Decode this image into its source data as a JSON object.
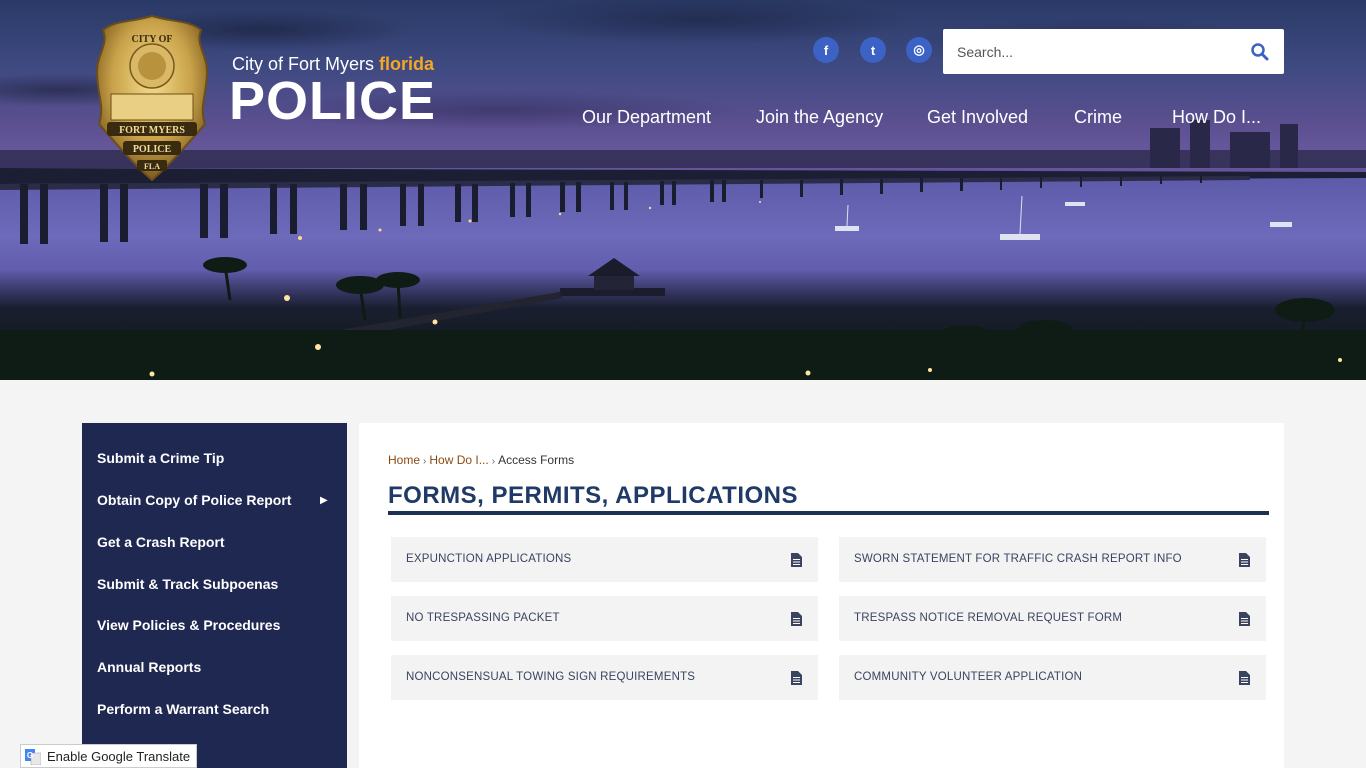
{
  "brand": {
    "city_text": "City of Fort Myers",
    "state_text": "florida",
    "main_text": "POLICE",
    "badge_top": "CITY OF",
    "badge_middle": "FORT MYERS",
    "badge_bottom": "POLICE",
    "badge_state": "FLA"
  },
  "social": {
    "facebook": "f",
    "twitter": "t",
    "instagram": "◎"
  },
  "search": {
    "placeholder": "Search..."
  },
  "nav": {
    "items": [
      {
        "label": "Our Department"
      },
      {
        "label": "Join the Agency"
      },
      {
        "label": "Get Involved"
      },
      {
        "label": "Crime"
      },
      {
        "label": "How Do I..."
      }
    ]
  },
  "sidebar": {
    "items": [
      {
        "label": "Submit a Crime Tip"
      },
      {
        "label": "Obtain Copy of Police Report",
        "arrow": "▶"
      },
      {
        "label": "Get a Crash Report"
      },
      {
        "label": "Submit & Track Subpoenas"
      },
      {
        "label": "View Policies & Procedures"
      },
      {
        "label": "Annual Reports"
      },
      {
        "label": "Perform a Warrant Search"
      }
    ]
  },
  "breadcrumb": {
    "home": "Home",
    "parent": "How Do I...",
    "current": "Access Forms",
    "separator": "›"
  },
  "page": {
    "title": "FORMS, PERMITS, APPLICATIONS"
  },
  "forms": [
    {
      "label": "EXPUNCTION APPLICATIONS"
    },
    {
      "label": "SWORN STATEMENT FOR TRAFFIC CRASH REPORT INFO"
    },
    {
      "label": "NO TRESPASSING PACKET"
    },
    {
      "label": "TRESPASS NOTICE REMOVAL REQUEST FORM"
    },
    {
      "label": "NONCONSENSUAL TOWING SIGN REQUIREMENTS"
    },
    {
      "label": "COMMUNITY VOLUNTEER APPLICATION"
    }
  ],
  "translate": {
    "label": "Enable Google Translate"
  },
  "colors": {
    "sidebar_bg": "#1f2851",
    "title": "#1f3a66",
    "accent_orange": "#f5a623",
    "social_blue": "#3b62c4",
    "breadcrumb_link": "#8a4a12"
  }
}
